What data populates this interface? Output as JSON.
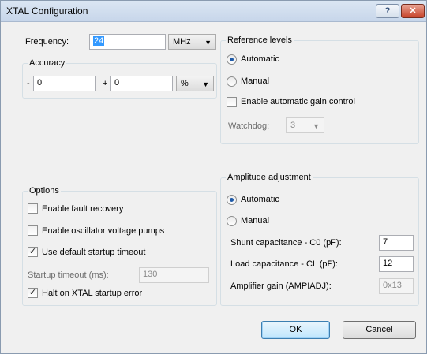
{
  "window": {
    "title": "XTAL Configuration",
    "help_label": "?",
    "close_label": "✕"
  },
  "frequency": {
    "label": "Frequency:",
    "value": "24",
    "unit": "MHz"
  },
  "accuracy": {
    "group_label": "Accuracy",
    "minus_sign": "-",
    "minus_value": "0",
    "plus_sign": "+",
    "plus_value": "0",
    "unit": "%"
  },
  "reference_levels": {
    "group_label": "Reference levels",
    "automatic_label": "Automatic",
    "automatic_selected": true,
    "manual_label": "Manual",
    "agc_label": "Enable automatic gain control",
    "agc_checked": false,
    "watchdog_label": "Watchdog:",
    "watchdog_value": "3"
  },
  "options": {
    "group_label": "Options",
    "fault_recovery_label": "Enable fault recovery",
    "fault_recovery_checked": false,
    "voltage_pumps_label": "Enable oscillator voltage pumps",
    "voltage_pumps_checked": false,
    "default_timeout_label": "Use default startup timeout",
    "default_timeout_checked": true,
    "startup_timeout_label": "Startup timeout (ms):",
    "startup_timeout_value": "130",
    "halt_label": "Halt on XTAL startup error",
    "halt_checked": true
  },
  "amplitude": {
    "group_label": "Amplitude adjustment",
    "automatic_label": "Automatic",
    "automatic_selected": true,
    "manual_label": "Manual",
    "shunt_label": "Shunt capacitance - C0 (pF):",
    "shunt_value": "7",
    "load_label": "Load capacitance - CL (pF):",
    "load_value": "12",
    "gain_label": "Amplifier gain (AMPIADJ):",
    "gain_value": "0x13"
  },
  "buttons": {
    "ok_label": "OK",
    "cancel_label": "Cancel"
  },
  "check_glyph": "✓"
}
